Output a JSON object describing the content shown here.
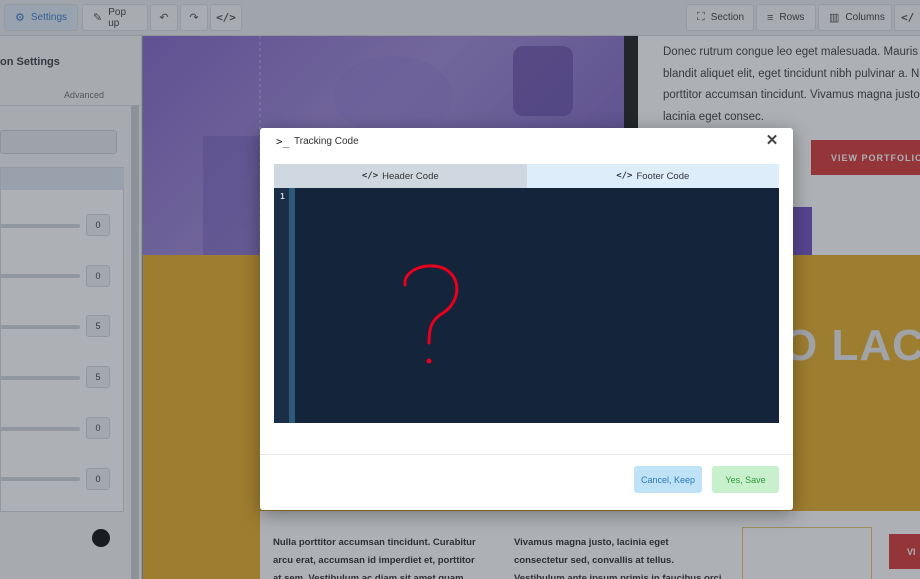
{
  "toolbar": {
    "settings_label": "Settings",
    "popup_label": "Pop up",
    "section_label": "Section",
    "rows_label": "Rows",
    "columns_label": "Columns"
  },
  "left_panel": {
    "title": "on Settings",
    "tab_advanced": "Advanced",
    "slider_values": [
      "0",
      "0",
      "5",
      "5",
      "0",
      "0"
    ]
  },
  "canvas": {
    "hero_lines": [
      "Donec rutrum congue leo eget malesuada. Mauris",
      "blandit aliquet elit, eget tincidunt nibh pulvinar a. Nu",
      "porttitor accumsan tincidunt. Vivamus magna justo,",
      "lacinia eget consec."
    ],
    "portfolio_button": "VIEW PORTFOLIO",
    "big_heading": "O LACI",
    "col1_lines": [
      "Nulla porttitor accumsan tincidunt. Curabitur",
      "arcu erat, accumsan id imperdiet et, porttitor",
      "at sem. Vestibulum ac diam sit amet quam"
    ],
    "col2_lines": [
      "Vivamus magna justo, lacinia eget",
      "consectetur sed, convallis at tellus.",
      "Vestibulum ante ipsum primis in faucibus orci"
    ],
    "view_button_2": "VI"
  },
  "modal": {
    "title": "Tracking Code",
    "tab_header": "Header Code",
    "tab_footer": "Footer Code",
    "line_number": "1",
    "cancel_label": "Cancel, Keep",
    "save_label": "Yes, Save",
    "annotation_color": "#e8001c"
  }
}
